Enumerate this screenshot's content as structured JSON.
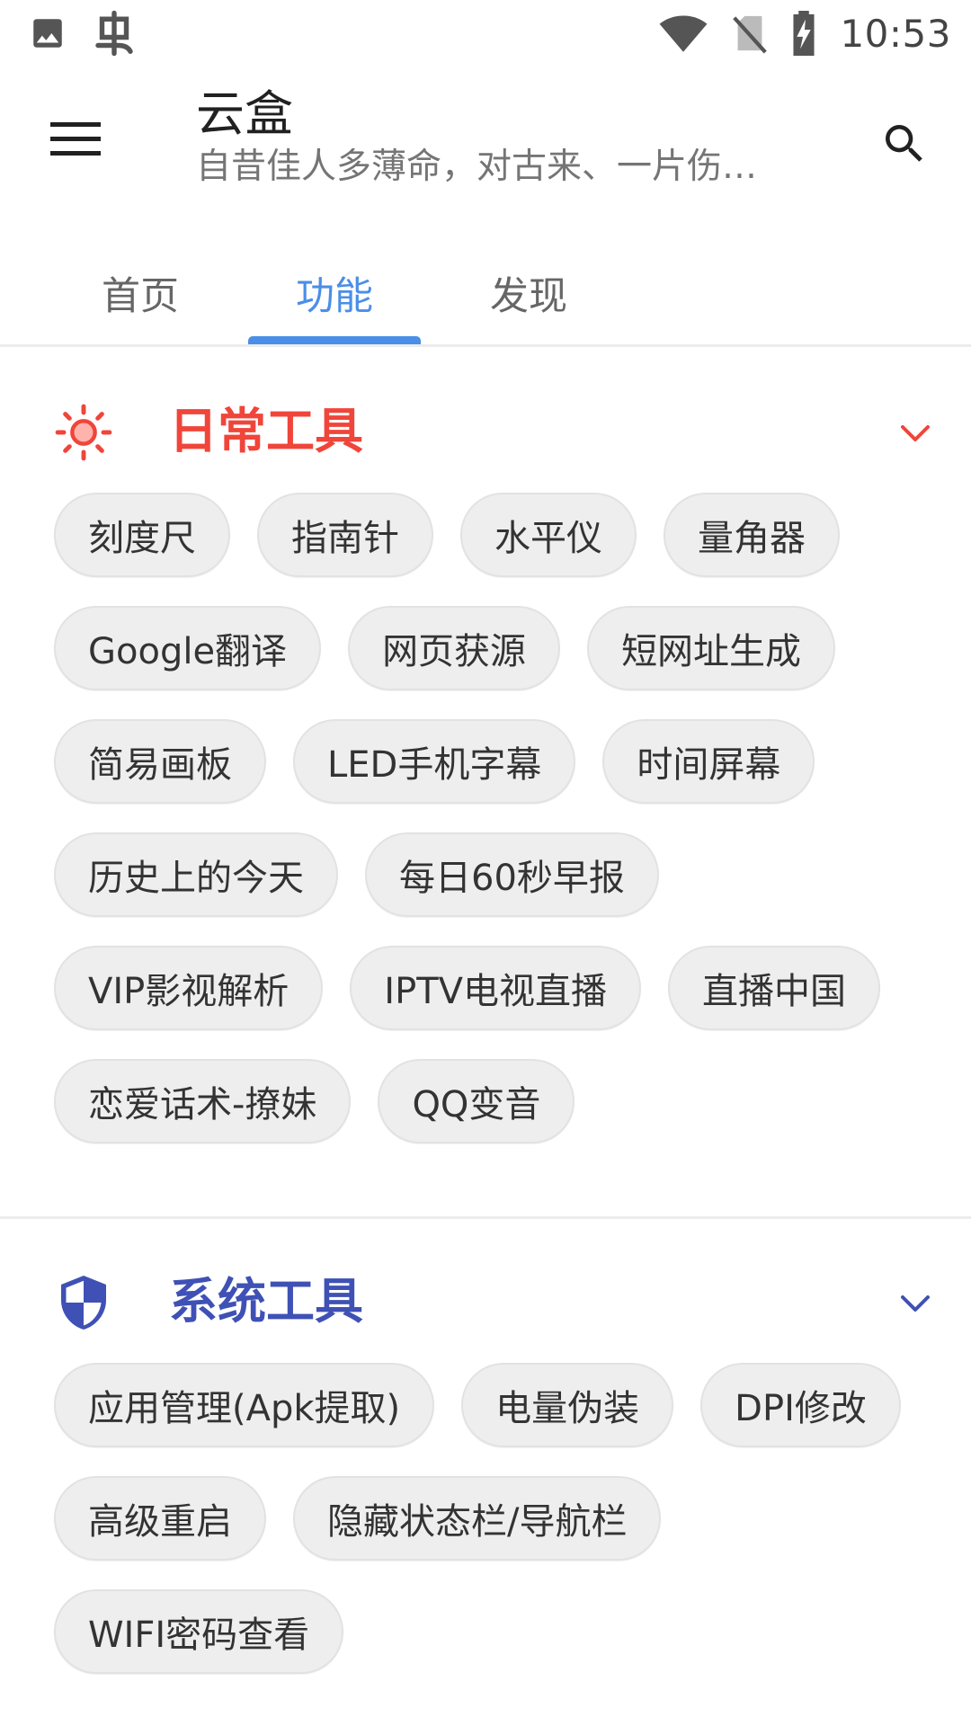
{
  "status_bar": {
    "time": "10:53",
    "left_icons": [
      "image-icon",
      "bug-app-icon"
    ],
    "right_icons": [
      "wifi-icon",
      "no-sim-icon",
      "battery-charging-icon"
    ]
  },
  "app_bar": {
    "title": "云盒",
    "subtitle": "自昔佳人多薄命，对古来、一片伤…"
  },
  "tabs": [
    {
      "label": "首页",
      "active": false
    },
    {
      "label": "功能",
      "active": true
    },
    {
      "label": "发现",
      "active": false
    }
  ],
  "sections": [
    {
      "title": "日常工具",
      "icon": "sun-icon",
      "color": "#f0453a",
      "chips": [
        "刻度尺",
        "指南针",
        "水平仪",
        "量角器",
        "Google翻译",
        "网页获源",
        "短网址生成",
        "简易画板",
        "LED手机字幕",
        "时间屏幕",
        "历史上的今天",
        "每日60秒早报",
        "VIP影视解析",
        "IPTV电视直播",
        "直播中国",
        "恋爱话术-撩妹",
        "QQ变音"
      ]
    },
    {
      "title": "系统工具",
      "icon": "shield-icon",
      "color": "#3f51b5",
      "chips": [
        "应用管理(Apk提取)",
        "电量伪装",
        "DPI修改",
        "高级重启",
        "隐藏状态栏/导航栏",
        "WIFI密码查看"
      ]
    }
  ],
  "colors": {
    "accent": "#4a8ee8",
    "chip_bg": "#eeeeee"
  }
}
